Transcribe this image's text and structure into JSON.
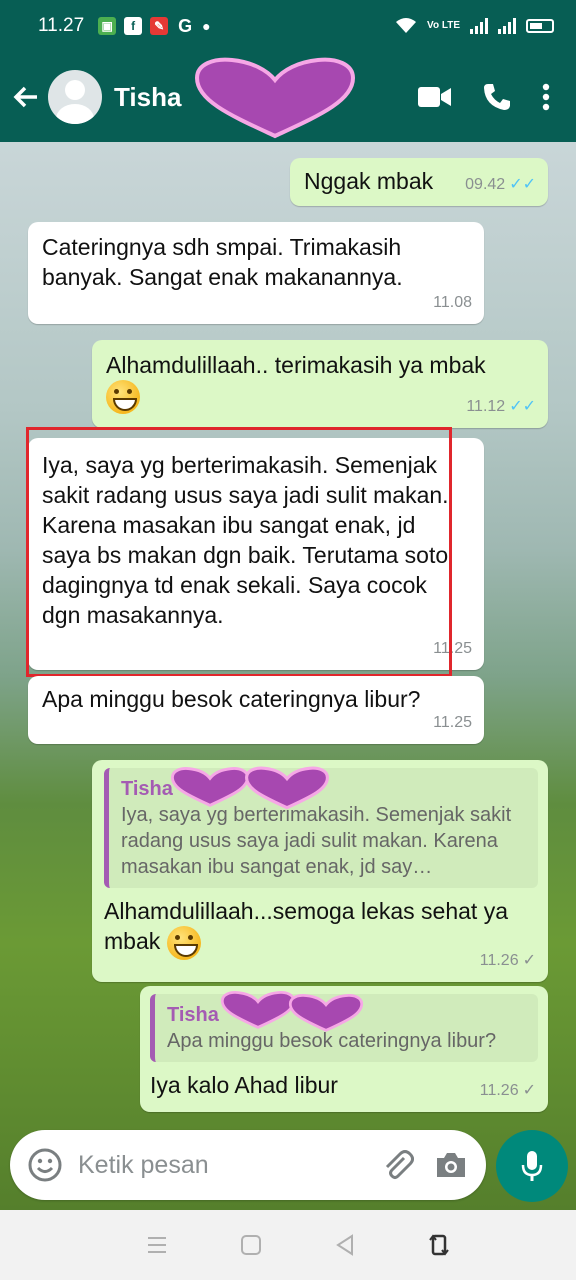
{
  "status_bar": {
    "time": "11.27",
    "notification_icons": [
      "app-icon",
      "facebook-icon",
      "messenger-icon",
      "google-icon",
      "dot-icon"
    ],
    "volte_label": "Vo LTE"
  },
  "header": {
    "contact_name": "Tisha",
    "icons": [
      "back-arrow-icon",
      "avatar",
      "video-call-icon",
      "phone-icon",
      "more-icon"
    ]
  },
  "messages": [
    {
      "id": 1,
      "direction": "out",
      "text": "Nggak mbak",
      "time": "09.42",
      "status": "read"
    },
    {
      "id": 2,
      "direction": "in",
      "text": "Cateringnya sdh smpai. Trimakasih banyak. Sangat enak makanannya.",
      "time": "11.08"
    },
    {
      "id": 3,
      "direction": "out",
      "text": "Alhamdulillaah.. terimakasih ya mbak",
      "emoji": "grinning-face",
      "time": "11.12",
      "status": "read"
    },
    {
      "id": 4,
      "direction": "in",
      "text": "Iya, saya yg berterimakasih. Semenjak sakit radang usus saya jadi sulit makan. Karena masakan ibu sangat enak, jd saya bs makan dgn baik. Terutama soto dagingnya td enak sekali. Saya cocok dgn masakannya.",
      "time": "11.25",
      "highlighted": true
    },
    {
      "id": 5,
      "direction": "in",
      "text": "Apa minggu besok cateringnya libur?",
      "time": "11.25"
    },
    {
      "id": 6,
      "direction": "out",
      "quote_name": "Tisha",
      "quote_text": "Iya, saya yg berterimakasih. Semenjak sakit radang usus saya jadi sulit makan. Karena masakan ibu sangat enak, jd say…",
      "text": "Alhamdulillaah...semoga lekas sehat ya mbak",
      "emoji": "grinning-face",
      "time": "11.26",
      "status": "sent"
    },
    {
      "id": 7,
      "direction": "out",
      "quote_name": "Tisha",
      "quote_text": "Apa minggu besok cateringnya libur?",
      "text": "Iya kalo Ahad libur",
      "time": "11.26",
      "status": "sent"
    }
  ],
  "input_bar": {
    "placeholder": "Ketik pesan",
    "icons": [
      "emoji-icon",
      "attach-icon",
      "camera-icon",
      "mic-icon"
    ]
  },
  "nav_bar": {
    "icons": [
      "menu-icon",
      "home-icon",
      "back-icon",
      "rotate-icon"
    ]
  },
  "colors": {
    "header": "#075e54",
    "outgoing_bubble": "#dcf8c6",
    "incoming_bubble": "#ffffff",
    "quote_name": "#a45bb3",
    "read_tick": "#4fc3f7",
    "mic_button": "#00897b",
    "highlight_box": "#e0262c",
    "censor_heart": "#a748b0"
  }
}
